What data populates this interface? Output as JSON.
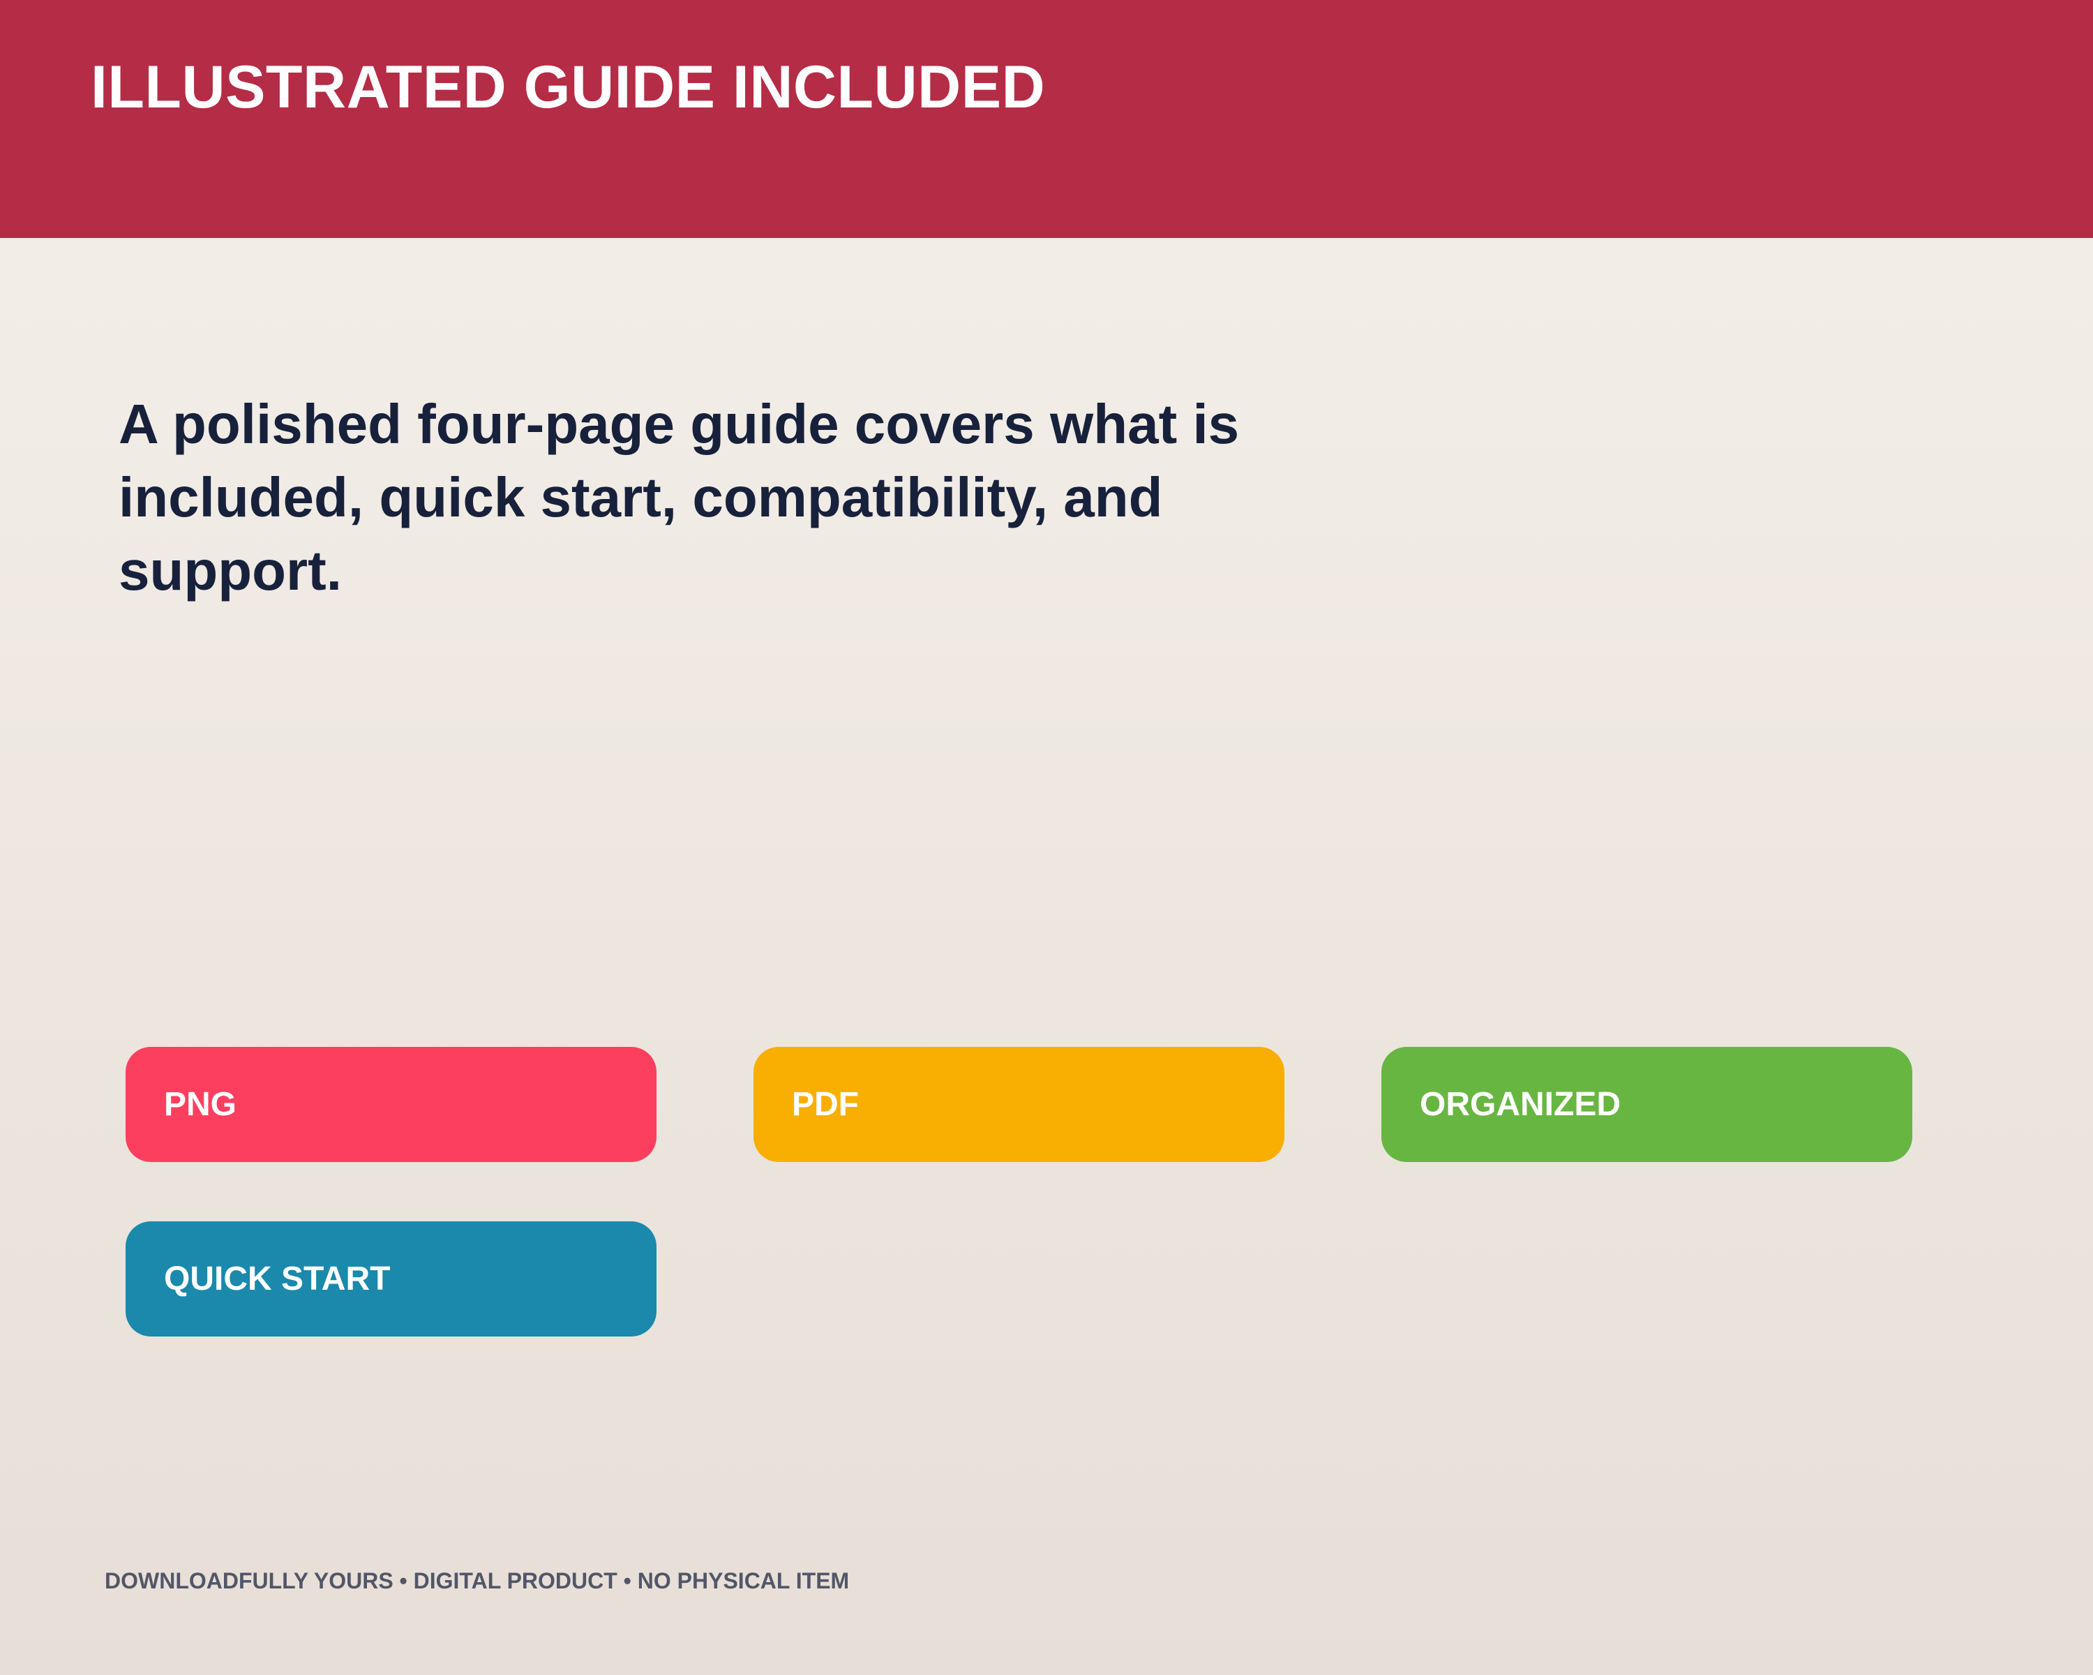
{
  "header": {
    "title": "ILLUSTRATED GUIDE INCLUDED",
    "background_color": "#b52c46"
  },
  "description": "A polished four-page guide covers what is included, quick start, compatibility, and support.",
  "tags": [
    {
      "label": "PNG",
      "color": "#fd3f5f"
    },
    {
      "label": "PDF",
      "color": "#f9ae02"
    },
    {
      "label": "ORGANIZED",
      "color": "#68b642"
    },
    {
      "label": "QUICK START",
      "color": "#1a89ac"
    }
  ],
  "footer": {
    "text": "DOWNLOADFULLY YOURS • DIGITAL PRODUCT • NO PHYSICAL ITEM"
  }
}
